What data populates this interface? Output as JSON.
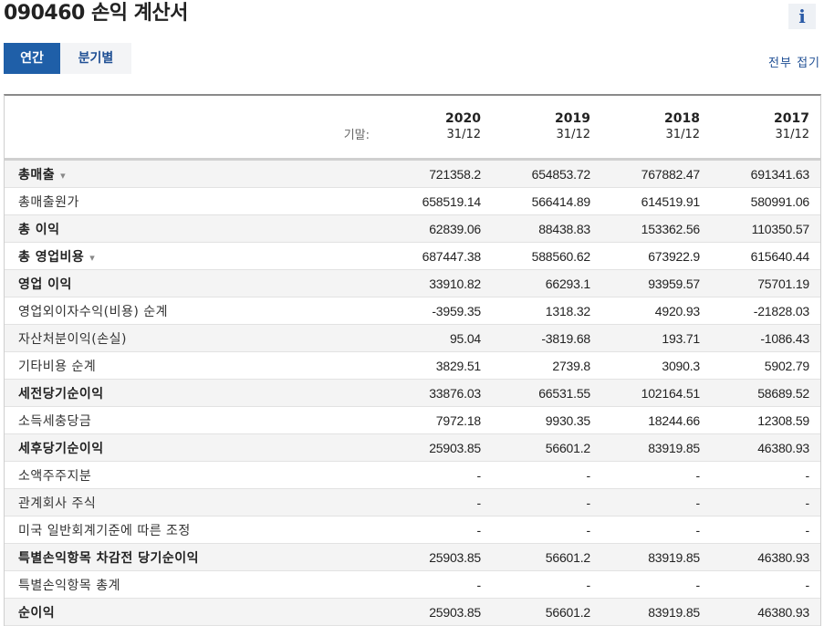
{
  "page": {
    "title": "090460 손익 계산서",
    "info_icon": "i"
  },
  "tabs": [
    {
      "label": "연간"
    },
    {
      "label": "분기별"
    }
  ],
  "collapse_all": "전부 접기",
  "table": {
    "period_label": "기말:",
    "columns": [
      {
        "year": "2020",
        "date": "31/12"
      },
      {
        "year": "2019",
        "date": "31/12"
      },
      {
        "year": "2018",
        "date": "31/12"
      },
      {
        "year": "2017",
        "date": "31/12"
      }
    ],
    "rows": [
      {
        "label": "총매출",
        "bold": true,
        "expandable": true,
        "values": [
          "721358.2",
          "654853.72",
          "767882.47",
          "691341.63"
        ]
      },
      {
        "label": "총매출원가",
        "bold": false,
        "values": [
          "658519.14",
          "566414.89",
          "614519.91",
          "580991.06"
        ]
      },
      {
        "label": "총 이익",
        "bold": true,
        "values": [
          "62839.06",
          "88438.83",
          "153362.56",
          "110350.57"
        ]
      },
      {
        "label": "총 영업비용",
        "bold": true,
        "expandable": true,
        "values": [
          "687447.38",
          "588560.62",
          "673922.9",
          "615640.44"
        ]
      },
      {
        "label": "영업 이익",
        "bold": true,
        "values": [
          "33910.82",
          "66293.1",
          "93959.57",
          "75701.19"
        ]
      },
      {
        "label": "영업외이자수익(비용) 순계",
        "bold": false,
        "values": [
          "-3959.35",
          "1318.32",
          "4920.93",
          "-21828.03"
        ]
      },
      {
        "label": "자산처분이익(손실)",
        "bold": false,
        "values": [
          "95.04",
          "-3819.68",
          "193.71",
          "-1086.43"
        ]
      },
      {
        "label": "기타비용 순계",
        "bold": false,
        "values": [
          "3829.51",
          "2739.8",
          "3090.3",
          "5902.79"
        ]
      },
      {
        "label": "세전당기순이익",
        "bold": true,
        "values": [
          "33876.03",
          "66531.55",
          "102164.51",
          "58689.52"
        ]
      },
      {
        "label": "소득세충당금",
        "bold": false,
        "values": [
          "7972.18",
          "9930.35",
          "18244.66",
          "12308.59"
        ]
      },
      {
        "label": "세후당기순이익",
        "bold": true,
        "values": [
          "25903.85",
          "56601.2",
          "83919.85",
          "46380.93"
        ]
      },
      {
        "label": "소액주주지분",
        "bold": false,
        "values": [
          "-",
          "-",
          "-",
          "-"
        ]
      },
      {
        "label": "관계회사 주식",
        "bold": false,
        "values": [
          "-",
          "-",
          "-",
          "-"
        ]
      },
      {
        "label": "미국 일반회계기준에 따른 조정",
        "bold": false,
        "values": [
          "-",
          "-",
          "-",
          "-"
        ]
      },
      {
        "label": "특별손익항목 차감전 당기순이익",
        "bold": true,
        "values": [
          "25903.85",
          "56601.2",
          "83919.85",
          "46380.93"
        ]
      },
      {
        "label": "특별손익항목 총계",
        "bold": false,
        "values": [
          "-",
          "-",
          "-",
          "-"
        ]
      },
      {
        "label": "순이익",
        "bold": true,
        "values": [
          "25903.85",
          "56601.2",
          "83919.85",
          "46380.93"
        ]
      }
    ]
  },
  "colors": {
    "accent": "#1f5fa8",
    "link": "#1f4f94",
    "row_shade": "#f4f4f4"
  },
  "icons": {
    "expand": "chevron-down-icon",
    "info": "info-icon"
  }
}
